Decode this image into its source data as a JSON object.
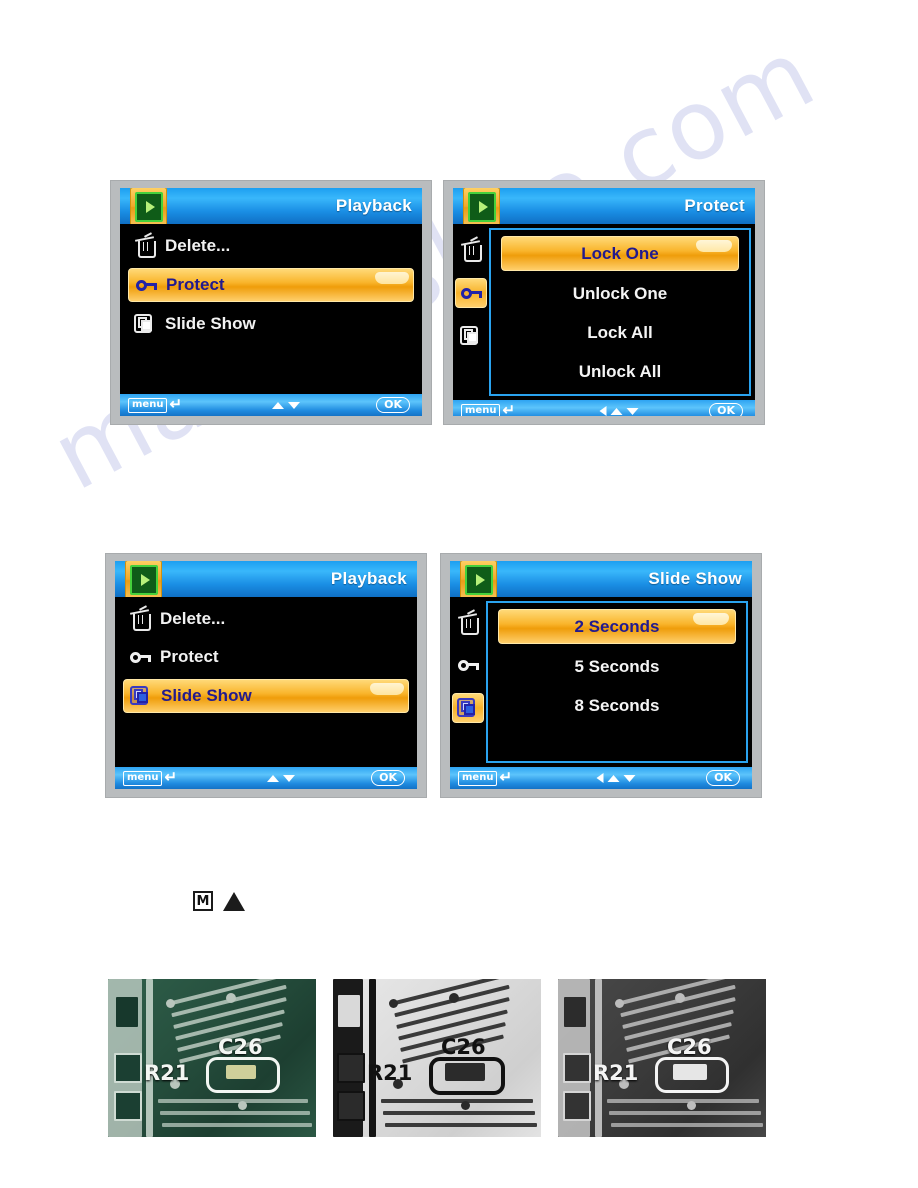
{
  "page": {
    "watermark_text": "manualslive.com"
  },
  "screens": [
    {
      "id": "playback-protect-highlight",
      "title": "Playback",
      "mode_icon": "playback-icon",
      "layout": "list",
      "items": [
        {
          "label": "Delete...",
          "icon": "trash-icon",
          "selected": false
        },
        {
          "label": "Protect",
          "icon": "key-icon",
          "selected": true
        },
        {
          "label": "Slide Show",
          "icon": "slideshow-icon",
          "selected": false
        }
      ],
      "bottom_bar": {
        "menu_label": "menu",
        "back_glyph": "return-arrow-icon",
        "arrows": [
          "up",
          "down"
        ],
        "ok_label": "OK"
      }
    },
    {
      "id": "protect-options",
      "title": "Protect",
      "mode_icon": "playback-icon",
      "layout": "pane",
      "sidebar": [
        {
          "icon": "trash-icon",
          "active": false
        },
        {
          "icon": "key-icon",
          "active": true
        },
        {
          "icon": "slideshow-icon",
          "active": false
        }
      ],
      "options": [
        {
          "label": "Lock One",
          "selected": true
        },
        {
          "label": "Unlock One",
          "selected": false
        },
        {
          "label": "Lock All",
          "selected": false
        },
        {
          "label": "Unlock All",
          "selected": false
        }
      ],
      "bottom_bar": {
        "menu_label": "menu",
        "back_glyph": "return-arrow-icon",
        "arrows": [
          "left",
          "up",
          "down"
        ],
        "ok_label": "OK"
      }
    },
    {
      "id": "playback-slideshow-highlight",
      "title": "Playback",
      "mode_icon": "playback-icon",
      "layout": "list",
      "items": [
        {
          "label": "Delete...",
          "icon": "trash-icon",
          "selected": false
        },
        {
          "label": "Protect",
          "icon": "key-icon",
          "selected": false
        },
        {
          "label": "Slide Show",
          "icon": "slideshow-icon",
          "selected": true
        }
      ],
      "bottom_bar": {
        "menu_label": "menu",
        "back_glyph": "return-arrow-icon",
        "arrows": [
          "up",
          "down"
        ],
        "ok_label": "OK"
      }
    },
    {
      "id": "slideshow-options",
      "title": "Slide Show",
      "mode_icon": "playback-icon",
      "layout": "pane",
      "sidebar": [
        {
          "icon": "trash-icon",
          "active": false
        },
        {
          "icon": "key-icon",
          "active": false
        },
        {
          "icon": "slideshow-icon",
          "active": true
        }
      ],
      "options": [
        {
          "label": "2 Seconds",
          "selected": true
        },
        {
          "label": "5 Seconds",
          "selected": false
        },
        {
          "label": "8 Seconds",
          "selected": false
        }
      ],
      "bottom_bar": {
        "menu_label": "menu",
        "back_glyph": "return-arrow-icon",
        "arrows": [
          "left",
          "up",
          "down"
        ],
        "ok_label": "OK"
      }
    }
  ],
  "button_row": {
    "mode_button_label": "M",
    "up_button_icon": "up-triangle-icon"
  },
  "photos": [
    {
      "id": "pcb-color",
      "variant": "color",
      "labels": {
        "resistor": "R21",
        "capacitor": "C26"
      }
    },
    {
      "id": "pcb-inverted",
      "variant": "inverted",
      "labels": {
        "resistor": "R21",
        "capacitor": "C26"
      }
    },
    {
      "id": "pcb-grayscale",
      "variant": "grayscale",
      "labels": {
        "resistor": "R21",
        "capacitor": "C26"
      }
    }
  ],
  "colors": {
    "titlebar_blue": "#1d9ff0",
    "highlight_orange": "#f9b52c",
    "highlight_text": "#221a8e",
    "screen_black": "#000000",
    "bezel_gray": "#b9bcbe",
    "option_border_blue": "#2aa3ef"
  }
}
